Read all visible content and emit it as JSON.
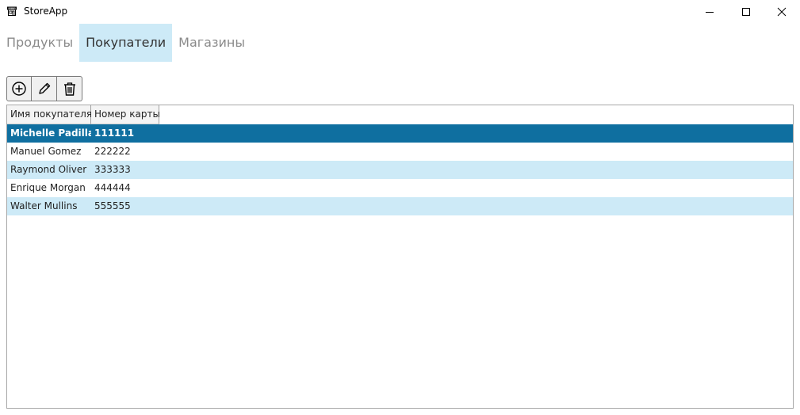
{
  "window": {
    "title": "StoreApp",
    "icon": "store-icon",
    "controls": [
      "minimize-icon",
      "maximize-icon",
      "close-icon"
    ]
  },
  "tabs": [
    {
      "label": "Продукты",
      "active": false
    },
    {
      "label": "Покупатели",
      "active": true
    },
    {
      "label": "Магазины",
      "active": false
    }
  ],
  "toolbar": {
    "buttons": [
      "add-icon",
      "edit-icon",
      "delete-icon"
    ]
  },
  "grid": {
    "columns": [
      "Имя покупателя",
      "Номер карты"
    ],
    "rows": [
      {
        "name": "Michelle Padilla",
        "card": "111111",
        "selected": true
      },
      {
        "name": "Manuel Gomez",
        "card": "222222"
      },
      {
        "name": "Raymond Oliver",
        "card": "333333"
      },
      {
        "name": "Enrique Morgan",
        "card": "444444"
      },
      {
        "name": "Walter Mullins",
        "card": "555555"
      }
    ]
  },
  "colors": {
    "selected_row": "#0f6fa0",
    "alt_row": "#cdeaf7",
    "active_tab": "#cdeaf7"
  }
}
